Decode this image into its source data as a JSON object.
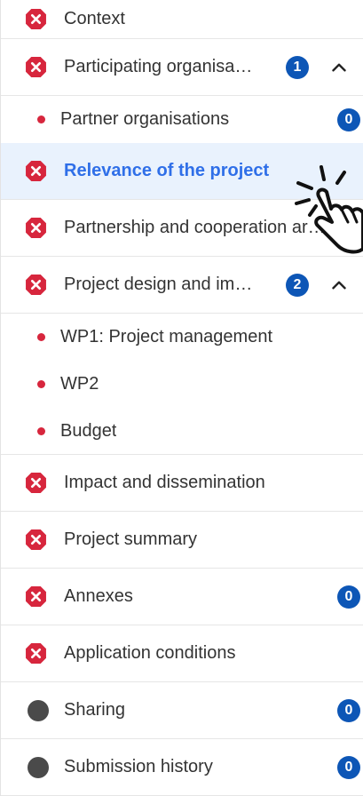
{
  "nav": {
    "context": {
      "label": "Context"
    },
    "participating": {
      "label": "Participating organisa…",
      "badge": "1"
    },
    "partner_orgs": {
      "label": "Partner organisations",
      "badge": "0"
    },
    "relevance": {
      "label": "Relevance of the project"
    },
    "partnership": {
      "label": "Partnership and cooperation ar…"
    },
    "project_design": {
      "label": "Project design and im…",
      "badge": "2"
    },
    "wp1": {
      "label": "WP1: Project management"
    },
    "wp2": {
      "label": "WP2"
    },
    "budget": {
      "label": "Budget"
    },
    "impact": {
      "label": "Impact and dissemination"
    },
    "summary": {
      "label": "Project summary"
    },
    "annexes": {
      "label": "Annexes",
      "badge": "0"
    },
    "conditions": {
      "label": "Application conditions"
    },
    "sharing": {
      "label": "Sharing",
      "badge": "0"
    },
    "history": {
      "label": "Submission history",
      "badge": "0"
    }
  },
  "colors": {
    "error": "#d7263d",
    "active_text": "#2f6fe8",
    "active_bg": "#e9f2fd",
    "badge": "#0d56b6"
  },
  "icons": {
    "error": "error-octagon-icon",
    "chevron": "chevron-up-icon",
    "cursor": "hand-pointer-icon"
  }
}
